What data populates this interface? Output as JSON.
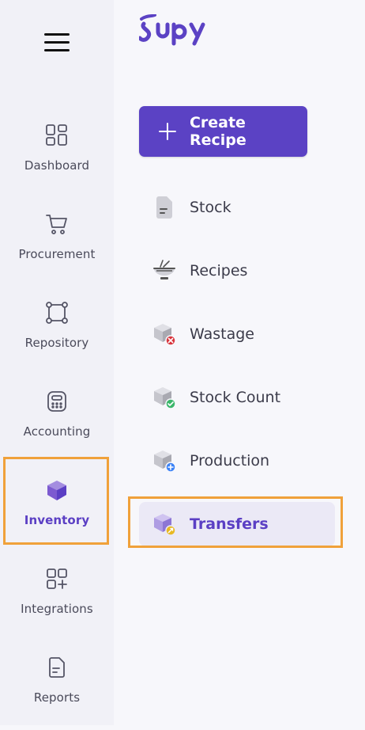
{
  "brand": {
    "logo_text": "supy",
    "color": "#5b42c4"
  },
  "rail": {
    "items": [
      {
        "label": "Dashboard",
        "icon": "dashboard-icon",
        "active": false
      },
      {
        "label": "Procurement",
        "icon": "cart-icon",
        "active": false
      },
      {
        "label": "Repository",
        "icon": "repository-icon",
        "active": false
      },
      {
        "label": "Accounting",
        "icon": "calculator-icon",
        "active": false
      },
      {
        "label": "Inventory",
        "icon": "cube-icon",
        "active": true
      },
      {
        "label": "Integrations",
        "icon": "integrations-icon",
        "active": false
      },
      {
        "label": "Reports",
        "icon": "reports-icon",
        "active": false
      }
    ]
  },
  "submenu": {
    "create_label": "Create Recipe",
    "items": [
      {
        "label": "Stock",
        "icon": "stock-document-icon",
        "active": false
      },
      {
        "label": "Recipes",
        "icon": "bowl-icon",
        "active": false
      },
      {
        "label": "Wastage",
        "icon": "box-wastage-icon",
        "active": false
      },
      {
        "label": "Stock Count",
        "icon": "box-check-icon",
        "active": false
      },
      {
        "label": "Production",
        "icon": "box-plus-icon",
        "active": false
      },
      {
        "label": "Transfers",
        "icon": "box-transfer-icon",
        "active": true
      }
    ]
  },
  "colors": {
    "accent": "#5b42c4",
    "highlight": "#f0a13a",
    "wastage_badge": "#d9363e",
    "stockcount_badge": "#3bb66b",
    "production_badge": "#3b82f6",
    "transfer_badge": "#e8b923"
  }
}
